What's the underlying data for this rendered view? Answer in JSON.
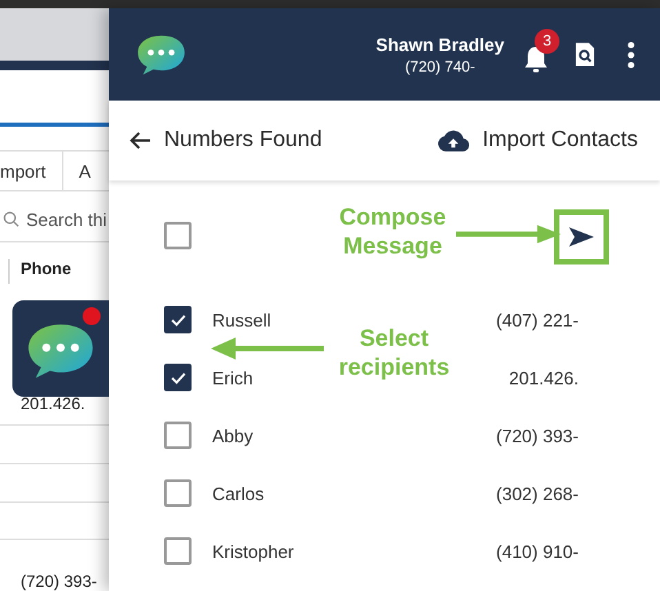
{
  "background_page": {
    "tabs": [
      {
        "label": "mport"
      },
      {
        "label": "A"
      }
    ],
    "search": {
      "placeholder": "Search thi"
    },
    "column_header": "Phone",
    "cells": [
      "201.426.",
      "(720) 393-"
    ]
  },
  "floating_app_button": {
    "notification": true
  },
  "panel": {
    "user_name": "Shawn Bradley",
    "user_phone": "(720) 740-",
    "notification_count": "3",
    "title": "Numbers Found",
    "import_button": "Import Contacts",
    "select_all": {
      "checked": false
    },
    "contacts": [
      {
        "name": "Russell",
        "phone": "(407) 221-",
        "checked": true
      },
      {
        "name": "Erich",
        "phone": "201.426.",
        "checked": true
      },
      {
        "name": "Abby",
        "phone": "(720) 393-",
        "checked": false
      },
      {
        "name": "Carlos",
        "phone": "(302) 268-",
        "checked": false
      },
      {
        "name": "Kristopher",
        "phone": "(410) 910-",
        "checked": false
      }
    ]
  },
  "annotations": [
    {
      "kind": "compose",
      "text": "Compose Message"
    },
    {
      "kind": "select",
      "text": "Select recipients"
    }
  ]
}
